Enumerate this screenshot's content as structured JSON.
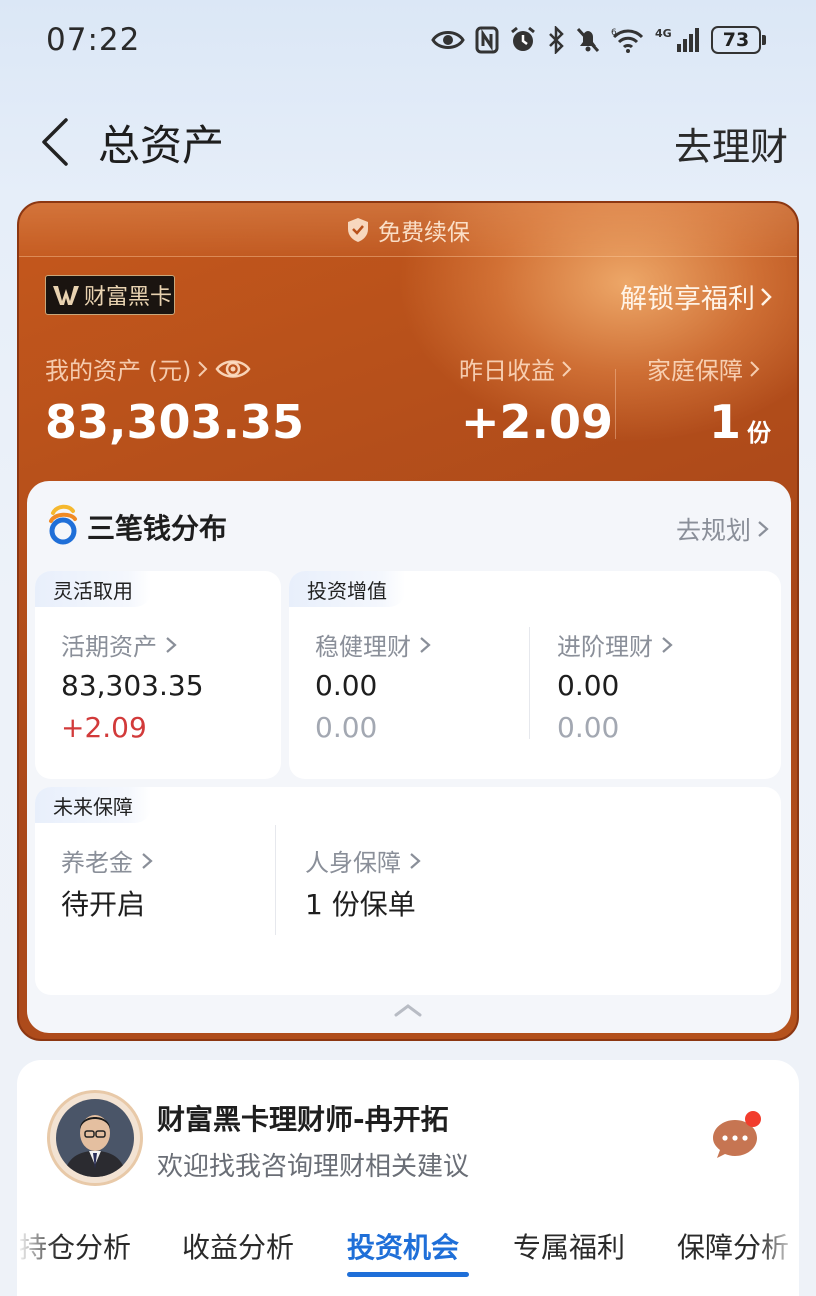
{
  "status_bar": {
    "time": "07:22",
    "network": "4G",
    "battery": "73",
    "icons": [
      "eye-icon",
      "nfc-icon",
      "alarm-icon",
      "bluetooth-icon",
      "mute-icon",
      "wifi-icon",
      "signal-icon",
      "battery-icon"
    ]
  },
  "header": {
    "title": "总资产",
    "action": "去理财"
  },
  "card": {
    "banner": "免费续保",
    "badge": "财富黑卡",
    "unlock": "解锁享福利",
    "assets_label": "我的资产 (元)",
    "assets_value": "83,303.35",
    "yesterday_label": "昨日收益",
    "yesterday_value": "+2.09",
    "family_label": "家庭保障",
    "family_value": "1",
    "family_unit": "份"
  },
  "distribution": {
    "title": "三笔钱分布",
    "link": "去规划",
    "flexible": {
      "tag": "灵活取用",
      "label": "活期资产",
      "value": "83,303.35",
      "change": "+2.09"
    },
    "invest": {
      "tag": "投资增值",
      "steady_label": "稳健理财",
      "steady_value": "0.00",
      "steady_change": "0.00",
      "advanced_label": "进阶理财",
      "advanced_value": "0.00",
      "advanced_change": "0.00"
    },
    "future": {
      "tag": "未来保障",
      "pension_label": "养老金",
      "pension_value": "待开启",
      "insurance_label": "人身保障",
      "insurance_value": "1 份保单"
    }
  },
  "advisor": {
    "name": "财富黑卡理财师-冉开拓",
    "desc": "欢迎找我咨询理财相关建议"
  },
  "tabs": [
    "持仓分析",
    "收益分析",
    "投资机会",
    "专属福利",
    "保障分析"
  ],
  "active_tab": "投资机会",
  "colors": {
    "accent": "#1f6fd8",
    "card_orange": "#b8511b",
    "gain_red": "#d23a3a"
  }
}
